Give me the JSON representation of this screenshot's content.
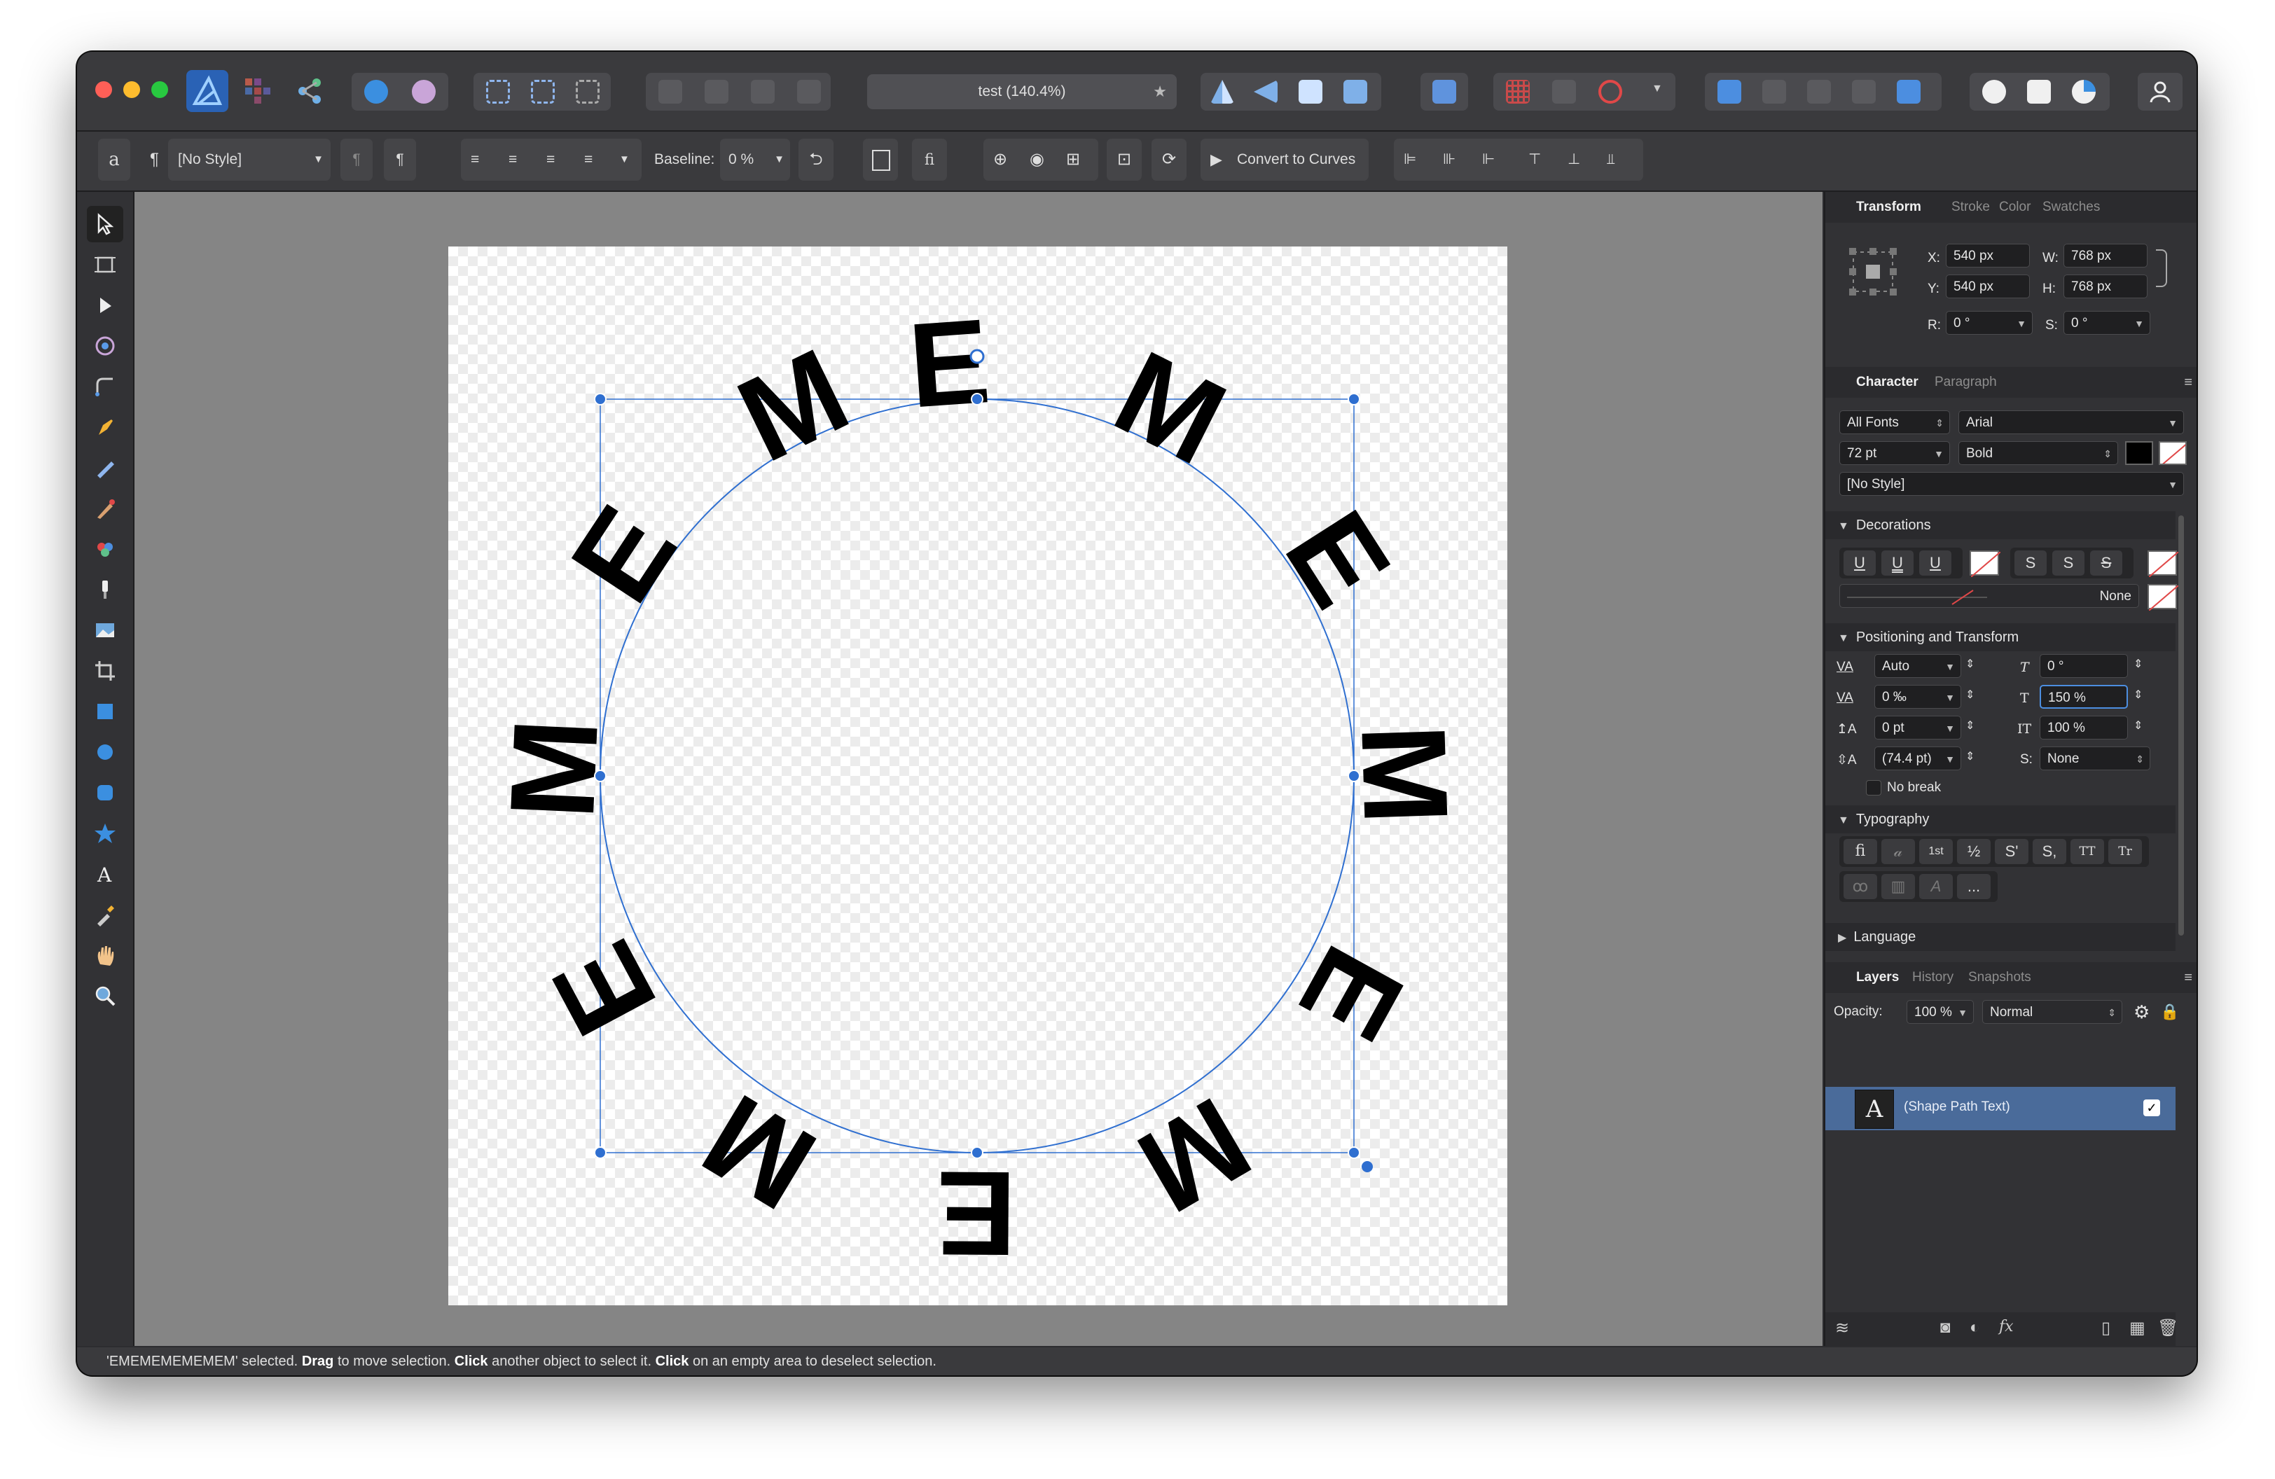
{
  "app": {
    "document_title": "test (140.4%)",
    "title_star": "★"
  },
  "context_toolbar": {
    "char_glyph": "a",
    "para_glyph": "¶",
    "style_select": "[No Style]",
    "baseline_label": "Baseline:",
    "baseline_value": "0 %",
    "ligature_glyph": "fi",
    "convert_label": "Convert to Curves"
  },
  "canvas": {
    "path_text": "EMEMEMEMEMEM"
  },
  "transform_panel": {
    "tabs": [
      "Transform",
      "Stroke",
      "Color",
      "Swatches"
    ],
    "x_label": "X:",
    "x_value": "540 px",
    "y_label": "Y:",
    "y_value": "540 px",
    "w_label": "W:",
    "w_value": "768 px",
    "h_label": "H:",
    "h_value": "768 px",
    "r_label": "R:",
    "r_value": "0 °",
    "s_label": "S:",
    "s_value": "0 °"
  },
  "character_panel": {
    "tabs": [
      "Character",
      "Paragraph"
    ],
    "font_collection": "All Fonts",
    "font_family": "Arial",
    "font_size": "72 pt",
    "font_weight": "Bold",
    "style": "[No Style]",
    "decorations": {
      "title": "Decorations",
      "underline_buttons": [
        "U",
        "U",
        "U"
      ],
      "strike_buttons": [
        "S",
        "S",
        "S"
      ],
      "line_style": "None"
    },
    "positioning": {
      "title": "Positioning and Transform",
      "kerning": "Auto",
      "tracking": "0 ‰",
      "baseline": "0 pt",
      "leading": "(74.4 pt)",
      "shear": "0 °",
      "vertical_scale": "150 %",
      "horizontal_scale": "100 %",
      "shear_amount": "None",
      "no_break": "No break"
    },
    "typography": {
      "title": "Typography",
      "buttons_row1": [
        "fi",
        "𝒶",
        "1st",
        "½",
        "S'",
        "S,",
        "TT",
        "Tr"
      ],
      "more": "..."
    },
    "language": {
      "title": "Language"
    }
  },
  "layers_panel": {
    "tabs": [
      "Layers",
      "History",
      "Snapshots"
    ],
    "opacity_label": "Opacity:",
    "opacity_value": "100 %",
    "blend_mode": "Normal",
    "layer_icon_glyph": "A",
    "layer_name": "(Shape Path Text)",
    "layer_check": "✓"
  },
  "status_bar": {
    "selection": "'EMEMEMEMEMEM' selected.",
    "drag": "Drag",
    "drag_tail": "to move selection.",
    "click1": "Click",
    "click1_tail": "another object to select it.",
    "click2": "Click",
    "click2_tail": "on an empty area to deselect selection."
  },
  "colors": {
    "accent": "#2f6fd0",
    "selection_row": "#4a6b9a",
    "chrome": "#3a3a3d",
    "canvas_bg": "#858585"
  }
}
